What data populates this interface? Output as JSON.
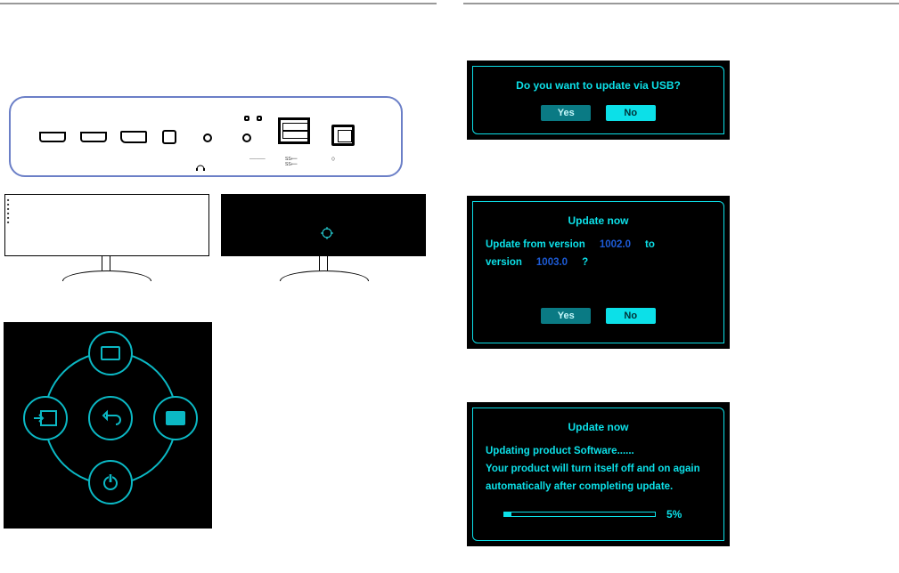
{
  "dialogs": {
    "d1": {
      "message": "Do you want to update via USB?",
      "yes": "Yes",
      "no": "No"
    },
    "d2": {
      "title": "Update now",
      "line1a": "Update  from  version",
      "ver_from": "1002.0",
      "line1b": "to",
      "line2a": "version",
      "ver_to": "1003.0",
      "qmark": "?",
      "yes": "Yes",
      "no": "No"
    },
    "d3": {
      "title": "Update now",
      "line1": "Updating  product  Software......",
      "line2": "Your  product  will  turn  itself  off  and  on  again automatically  after  completing  update.",
      "pct_label": "5%",
      "pct_value": 5
    }
  }
}
